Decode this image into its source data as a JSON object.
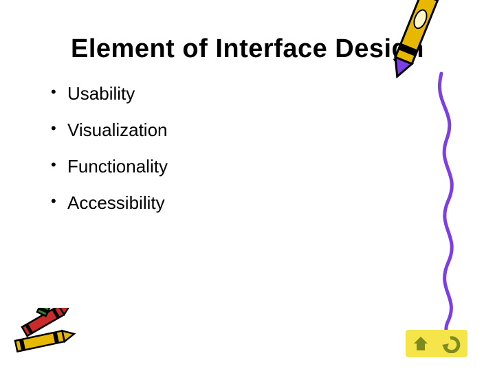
{
  "title": "Element of Interface Design",
  "bullets": [
    "Usability",
    "Visualization",
    "Functionality",
    "Accessibility"
  ],
  "icons": {
    "crayon_top": "yellow-crayon-squiggle",
    "crayons_bottom_left": "crayon-pile",
    "home": "home-icon",
    "back": "back-arrow-icon"
  },
  "colors": {
    "squiggle": "#7b3fe4",
    "crayon_yellow": "#e7b800",
    "crayon_red": "#c92a2a",
    "crayon_green": "#2e8b2e",
    "nav_bg": "#f6e54a",
    "nav_fg": "#7c8a1f"
  }
}
